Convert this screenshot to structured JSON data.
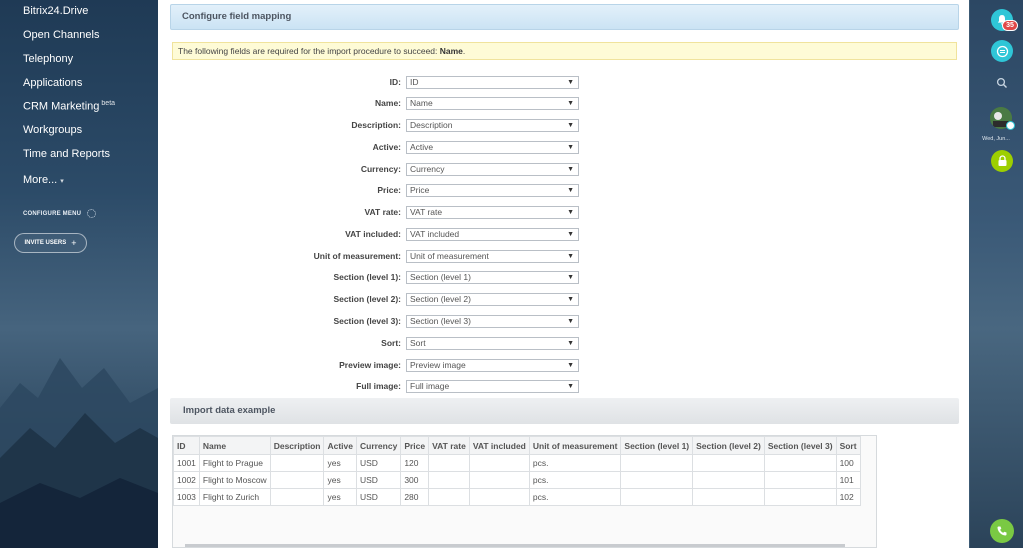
{
  "sidebar": {
    "items": [
      {
        "label": "Bitrix24.Drive"
      },
      {
        "label": "Open Channels"
      },
      {
        "label": "Telephony"
      },
      {
        "label": "Applications"
      },
      {
        "label": "CRM Marketing",
        "badge": "beta"
      },
      {
        "label": "Workgroups"
      },
      {
        "label": "Time and Reports"
      },
      {
        "label": "More..."
      }
    ],
    "configure_menu": "CONFIGURE MENU",
    "invite_users": "INVITE USERS"
  },
  "main": {
    "section_title": "Configure field mapping",
    "notice_prefix": "The following fields are required for the import procedure to succeed: ",
    "notice_required": "Name",
    "notice_suffix": ".",
    "fields": [
      {
        "label": "ID:",
        "value": "ID"
      },
      {
        "label": "Name:",
        "value": "Name"
      },
      {
        "label": "Description:",
        "value": "Description"
      },
      {
        "label": "Active:",
        "value": "Active"
      },
      {
        "label": "Currency:",
        "value": "Currency"
      },
      {
        "label": "Price:",
        "value": "Price"
      },
      {
        "label": "VAT rate:",
        "value": "VAT rate"
      },
      {
        "label": "VAT included:",
        "value": "VAT included"
      },
      {
        "label": "Unit of measurement:",
        "value": "Unit of measurement"
      },
      {
        "label": "Section (level 1):",
        "value": "Section (level 1)"
      },
      {
        "label": "Section (level 2):",
        "value": "Section (level 2)"
      },
      {
        "label": "Section (level 3):",
        "value": "Section (level 3)"
      },
      {
        "label": "Sort:",
        "value": "Sort"
      },
      {
        "label": "Preview image:",
        "value": "Preview image"
      },
      {
        "label": "Full image:",
        "value": "Full image"
      }
    ],
    "example_title": "Import data example",
    "table": {
      "columns": [
        "ID",
        "Name",
        "Description",
        "Active",
        "Currency",
        "Price",
        "VAT rate",
        "VAT included",
        "Unit of measurement",
        "Section (level 1)",
        "Section (level 2)",
        "Section (level 3)",
        "Sort"
      ],
      "rows": [
        [
          "1001",
          "Flight to Prague",
          "",
          "yes",
          "USD",
          "120",
          "",
          "",
          "pcs.",
          "",
          "",
          "",
          "100"
        ],
        [
          "1002",
          "Flight to Moscow",
          "",
          "yes",
          "USD",
          "300",
          "",
          "",
          "pcs.",
          "",
          "",
          "",
          "101"
        ],
        [
          "1003",
          "Flight to Zurich",
          "",
          "yes",
          "USD",
          "280",
          "",
          "",
          "pcs.",
          "",
          "",
          "",
          "102"
        ]
      ]
    }
  },
  "rightbar": {
    "notification_count": "35",
    "date_label": "Wed, Jun..."
  },
  "colors": {
    "header_blue": "#cbe3f4",
    "notice_yellow": "#fefbd6",
    "accent_teal": "#2fc6d7",
    "lock_green": "#9dcf00",
    "phone_green": "#7ac943",
    "badge_red": "#e04848"
  },
  "icons": {
    "notifications": "bell-icon",
    "chat": "chat-icon",
    "search": "search-icon",
    "lock": "lock-icon",
    "phone": "phone-icon",
    "settings": "gear-icon"
  }
}
